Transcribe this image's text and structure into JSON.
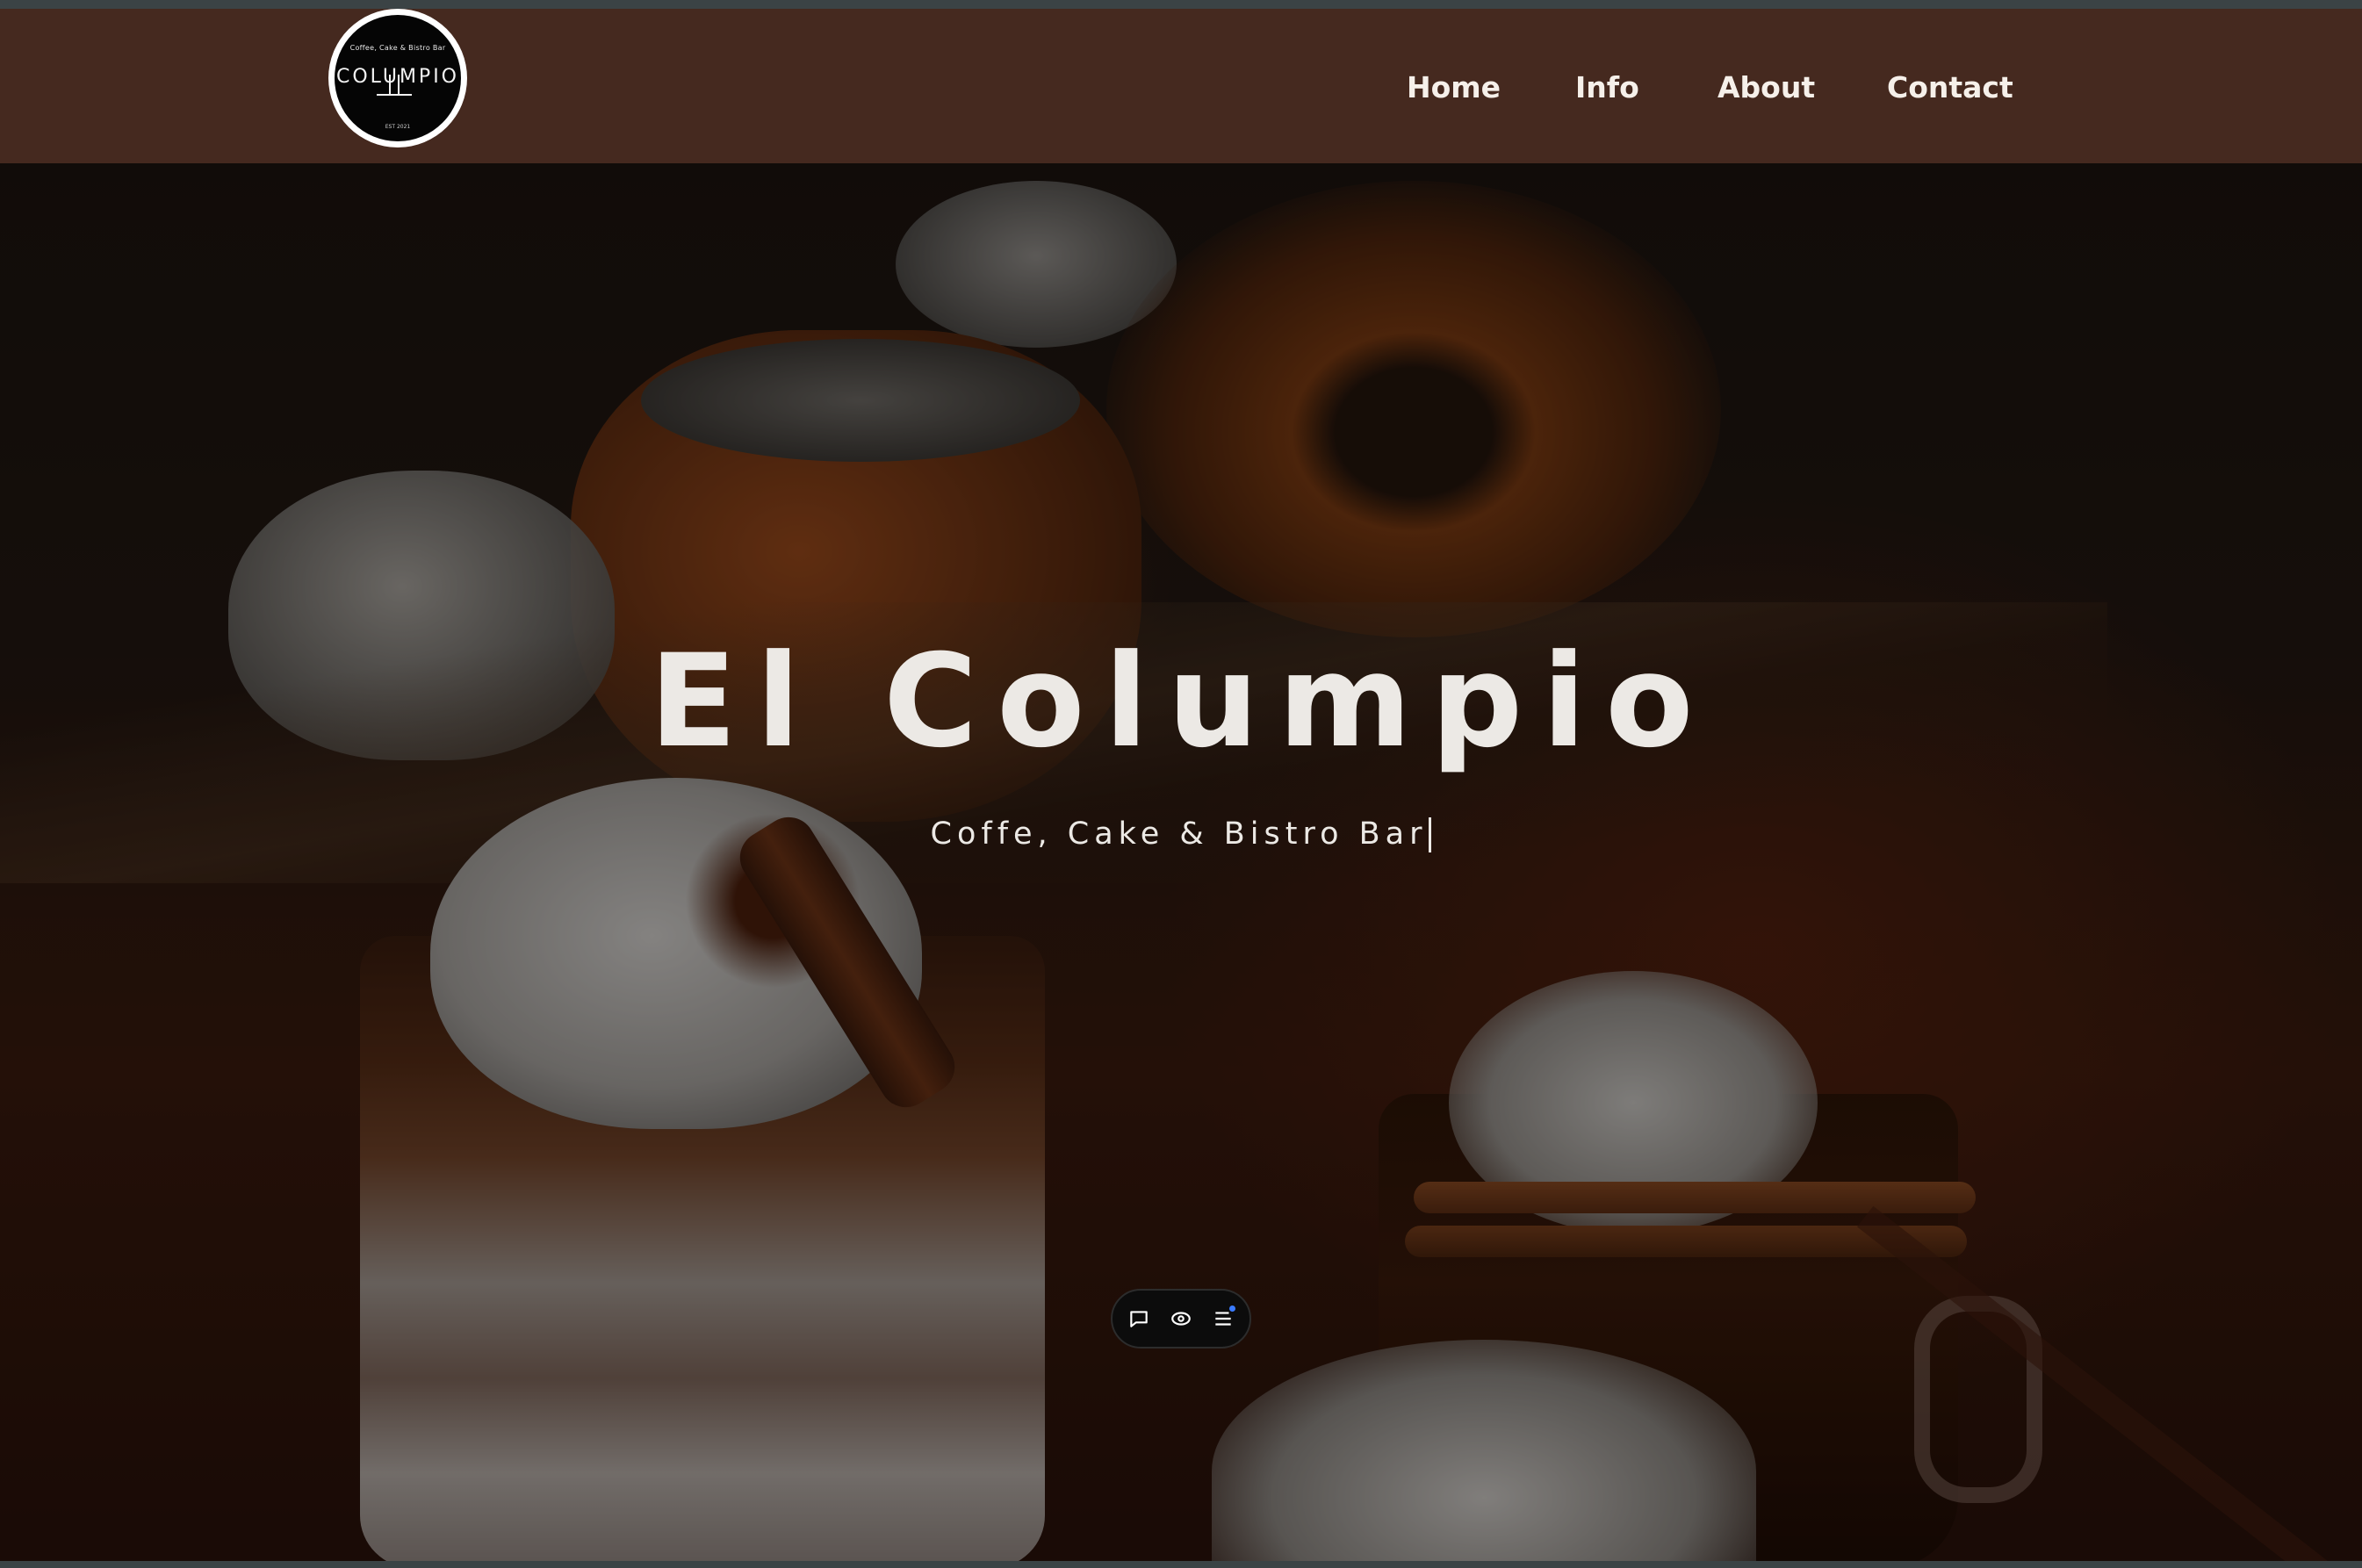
{
  "header": {
    "background_color": "#45291f",
    "logo": {
      "tagline": "Coffee, Cake & Bistro Bar",
      "name": "COLUMPIO",
      "est": "EST 2021"
    },
    "nav": [
      {
        "label": "Home"
      },
      {
        "label": "Info"
      },
      {
        "label": "About"
      },
      {
        "label": "Contact"
      }
    ]
  },
  "hero": {
    "title": "El Columpio",
    "subtitle": "Coffe, Cake & Bistro Bar",
    "text_color": "#ece9e5"
  },
  "floating_toolbar": {
    "buttons": [
      {
        "icon": "comment-icon"
      },
      {
        "icon": "eye-icon"
      },
      {
        "icon": "menu-list-icon"
      }
    ],
    "notification_dot_color": "#3a7bff"
  }
}
